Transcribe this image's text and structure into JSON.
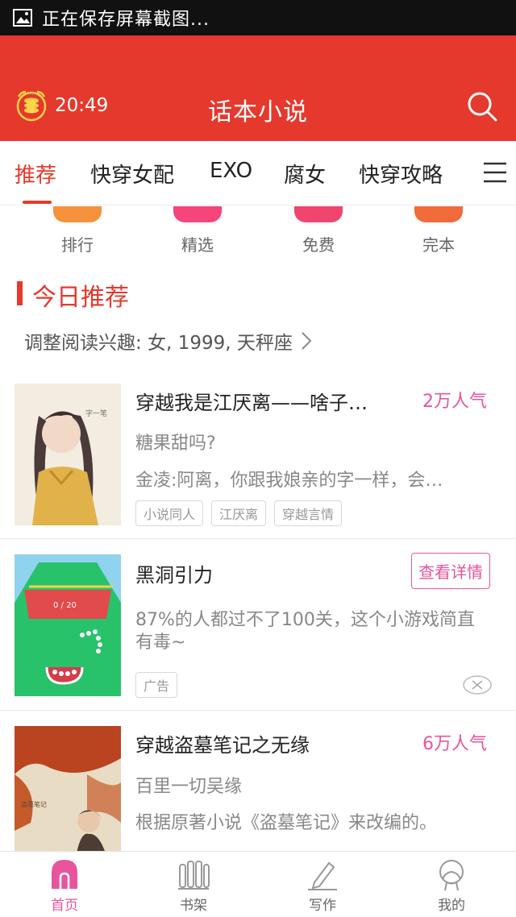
{
  "status_bar": {
    "text": "正在保存屏幕截图..."
  },
  "header": {
    "time": "20:49",
    "title": "话本小说"
  },
  "tabs": [
    {
      "label": "推荐",
      "active": true
    },
    {
      "label": "快穿女配"
    },
    {
      "label": "EXO"
    },
    {
      "label": "腐女"
    },
    {
      "label": "快穿攻略"
    }
  ],
  "categories": [
    {
      "label": "排行",
      "color": "#f6923c"
    },
    {
      "label": "精选",
      "color": "#f5457a"
    },
    {
      "label": "免费",
      "color": "#f0466e"
    },
    {
      "label": "完本",
      "color": "#f26b3a"
    }
  ],
  "section": {
    "title": "今日推荐",
    "interest_link": "调整阅读兴趣: 女, 1999, 天秤座"
  },
  "books": [
    {
      "title": "穿越我是江厌离——啥子…",
      "popularity": "2万人气",
      "subtitle": "糖果甜吗?",
      "snippet": "金凌:阿离，你跟我娘亲的字一样，会…",
      "tags": [
        "小说同人",
        "江厌离",
        "穿越言情"
      ]
    },
    {
      "title": "穿越盗墓笔记之无缘",
      "popularity": "6万人气",
      "subtitle": "百里一切吴缘",
      "snippet": "根据原著小说《盗墓笔记》来改编的。"
    }
  ],
  "ad": {
    "title": "黑洞引力",
    "button": "查看详情",
    "description": "87%的人都过不了100关，这个小游戏简直有毒~",
    "tag": "广告",
    "score_text": "0 / 20"
  },
  "bottom_nav": [
    {
      "label": "首页",
      "active": true
    },
    {
      "label": "书架"
    },
    {
      "label": "写作"
    },
    {
      "label": "我的"
    }
  ],
  "colors": {
    "brand_red": "#e5392d",
    "accent_pink": "#e8559d"
  }
}
